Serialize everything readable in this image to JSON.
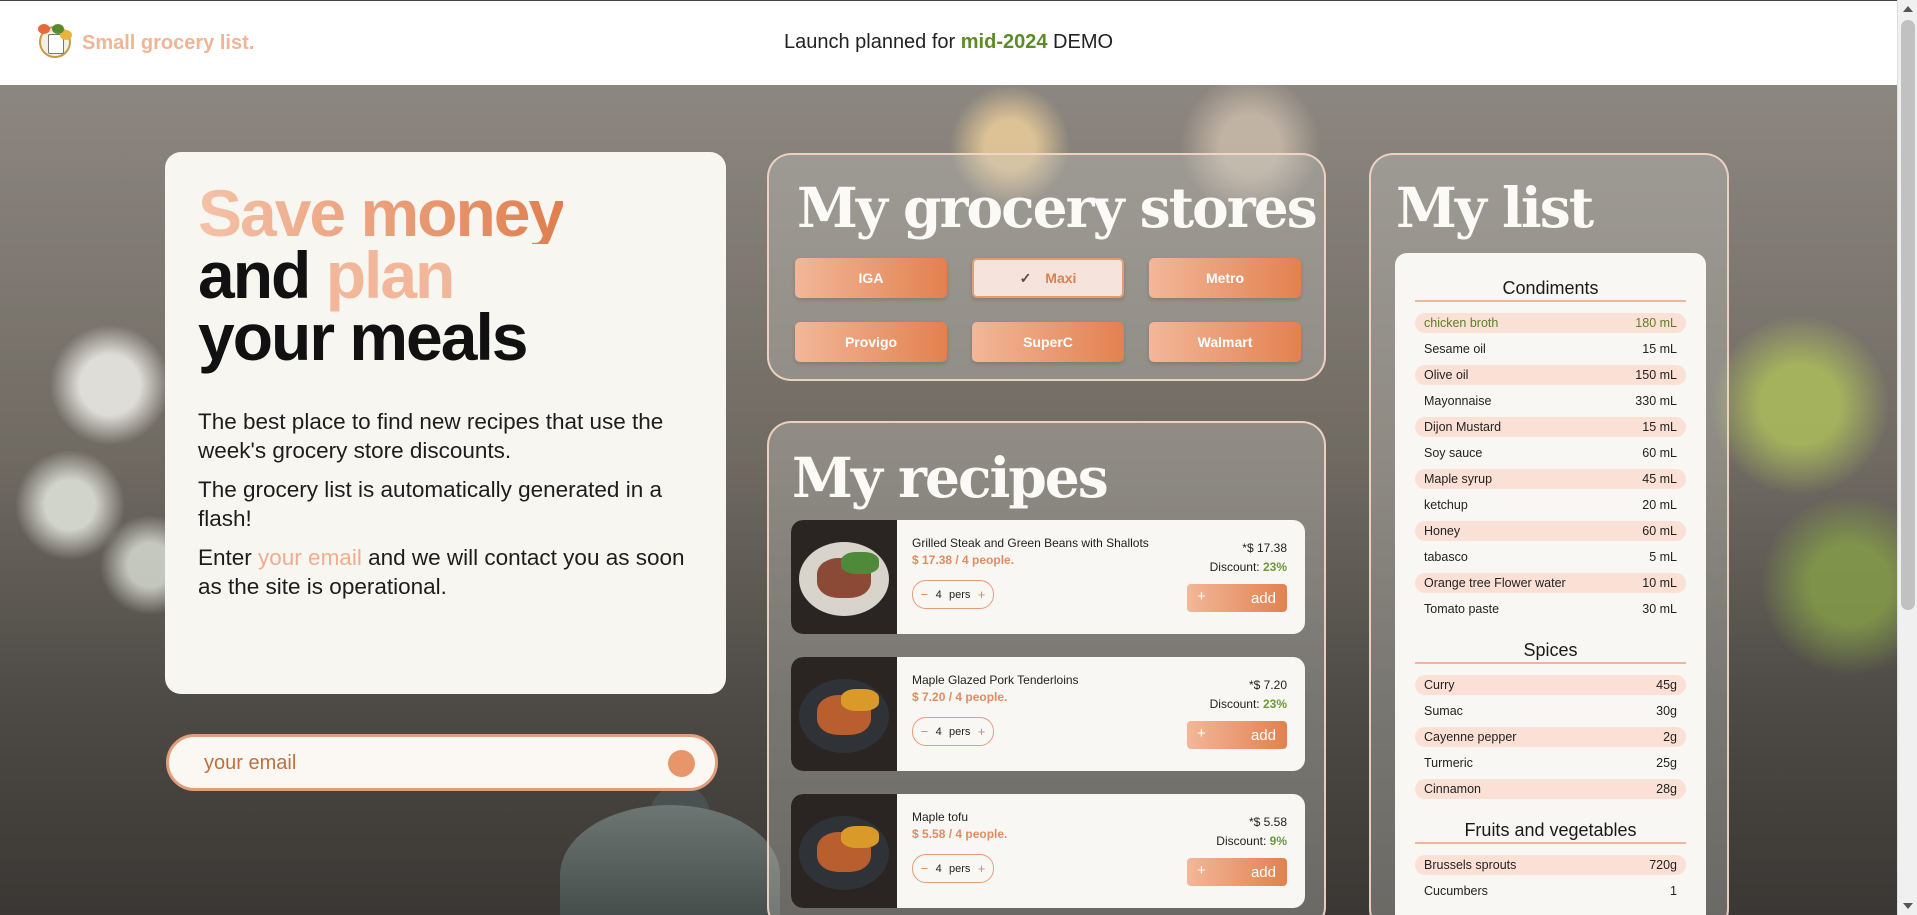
{
  "header": {
    "brand": "Small grocery list.",
    "announce_prefix": "Launch planned for ",
    "announce_highlight": "mid-2024",
    "announce_suffix": " DEMO"
  },
  "hero": {
    "title_line1": "Save money",
    "title_and": "and ",
    "title_plan": "plan",
    "title_line3": "your meals",
    "para1": "The best place to find new recipes that use the week's grocery store discounts.",
    "para2": "The grocery list is automatically generated in a flash!",
    "para3_prefix": "Enter ",
    "para3_link": "your email",
    "para3_suffix": " and we will contact you as soon as the site is operational."
  },
  "email": {
    "placeholder": "your email"
  },
  "stores": {
    "title": "My grocery stores",
    "items": [
      {
        "label": "IGA",
        "selected": false
      },
      {
        "label": "Maxi",
        "selected": true
      },
      {
        "label": "Metro",
        "selected": false
      },
      {
        "label": "Provigo",
        "selected": false
      },
      {
        "label": "SuperC",
        "selected": false
      },
      {
        "label": "Walmart",
        "selected": false
      }
    ],
    "check_icon": "✓"
  },
  "recipes": {
    "title": "My recipes",
    "pers_label": "pers",
    "add_label": "add",
    "discount_label": "Discount: ",
    "items": [
      {
        "name": "Grilled Steak and Green Beans with Shallots",
        "price_line": "$ 17.38 / 4 people.",
        "total": "*$ 17.38",
        "discount": "23%",
        "persons": "4"
      },
      {
        "name": "Maple Glazed Pork Tenderloins",
        "price_line": "$ 7.20 / 4 people.",
        "total": "*$ 7.20",
        "discount": "23%",
        "persons": "4"
      },
      {
        "name": "Maple tofu",
        "price_line": "$ 5.58 / 4 people.",
        "total": "*$ 5.58",
        "discount": "9%",
        "persons": "4"
      }
    ]
  },
  "mylist": {
    "title": "My list",
    "categories": [
      {
        "title": "Condiments",
        "items": [
          {
            "name": "chicken broth",
            "qty": "180 mL"
          },
          {
            "name": "Sesame oil",
            "qty": "15 mL"
          },
          {
            "name": "Olive oil",
            "qty": "150 mL"
          },
          {
            "name": "Mayonnaise",
            "qty": "330 mL"
          },
          {
            "name": "Dijon Mustard",
            "qty": "15 mL"
          },
          {
            "name": "Soy sauce",
            "qty": "60 mL"
          },
          {
            "name": "Maple syrup",
            "qty": "45 mL"
          },
          {
            "name": "ketchup",
            "qty": "20 mL"
          },
          {
            "name": "Honey",
            "qty": "60 mL"
          },
          {
            "name": "tabasco",
            "qty": "5 mL"
          },
          {
            "name": "Orange tree Flower water",
            "qty": "10 mL"
          },
          {
            "name": "Tomato paste",
            "qty": "30 mL"
          }
        ]
      },
      {
        "title": "Spices",
        "items": [
          {
            "name": "Curry",
            "qty": "45g"
          },
          {
            "name": "Sumac",
            "qty": "30g"
          },
          {
            "name": "Cayenne pepper",
            "qty": "2g"
          },
          {
            "name": "Turmeric",
            "qty": "25g"
          },
          {
            "name": "Cinnamon",
            "qty": "28g"
          }
        ]
      },
      {
        "title": "Fruits and vegetables",
        "items": [
          {
            "name": "Brussels sprouts",
            "qty": "720g"
          },
          {
            "name": "Cucumbers",
            "qty": "1"
          }
        ]
      }
    ]
  },
  "colors": {
    "accent": "#e2814f",
    "accent_light": "#f2b799",
    "highlight_green": "#5c8c28"
  }
}
